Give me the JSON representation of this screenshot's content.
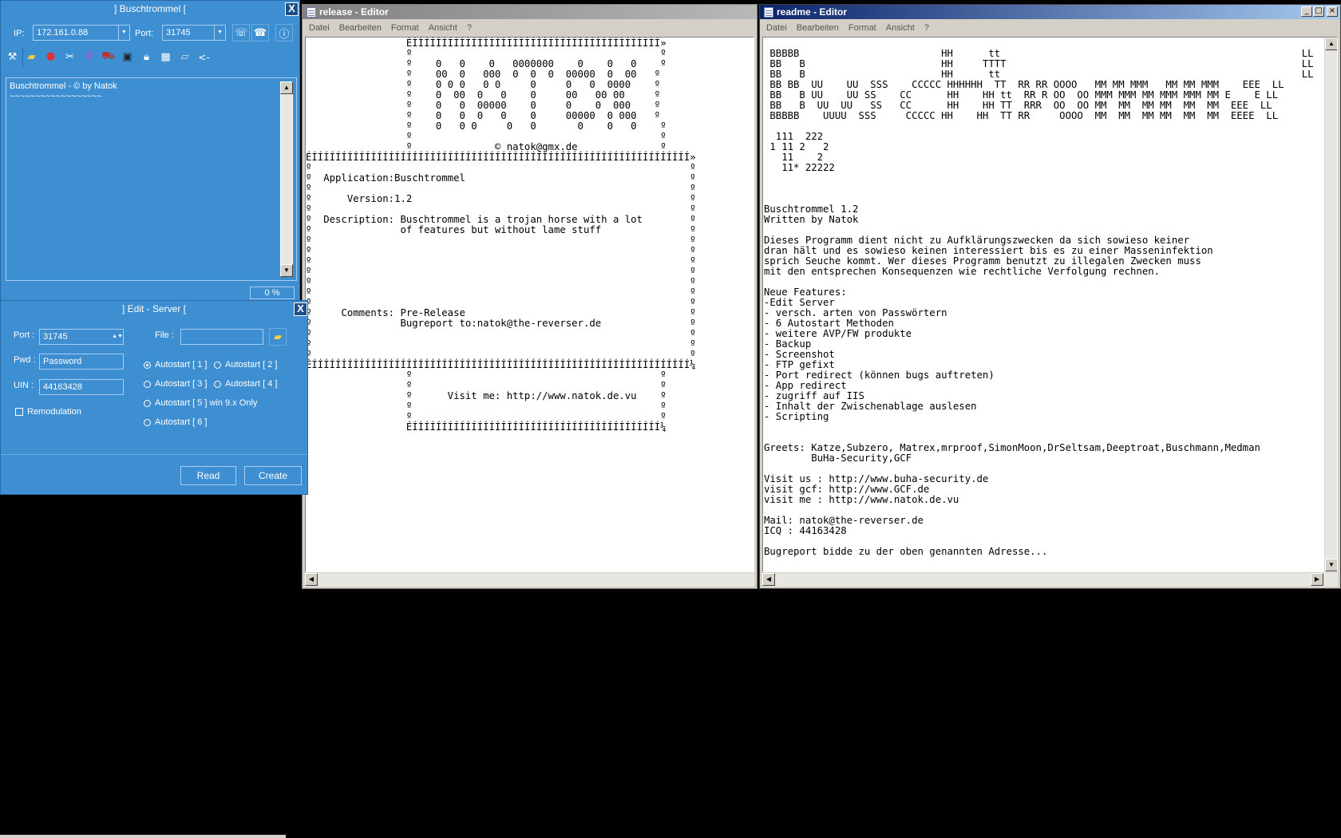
{
  "client": {
    "title": "] Buschtrommel [",
    "close": "X",
    "ip_label": "IP:",
    "ip_value": "172.161.0.88",
    "port_label": "Port:",
    "port_value": "31745",
    "log_lines": [
      "Buschtrommel - © by Natok",
      "~~~~~~~~~~~~~~~~~~"
    ],
    "progress": "0 %",
    "progress_value": 0,
    "toolbar_back": "<-"
  },
  "edit_server": {
    "title": "] Edit - Server [",
    "close": "X",
    "port_label": "Port :",
    "port_value": "31745",
    "pwd_label": "Pwd :",
    "pwd_value": "Password",
    "uin_label": "UIN :",
    "uin_value": "44163428",
    "file_label": "File :",
    "file_value": "",
    "remodulation_label": "Remodulation",
    "autostart": [
      "Autostart  [ 1 ]",
      "Autostart  [ 2 ]",
      "Autostart  [ 3 ]",
      "Autostart  [ 4 ]",
      "Autostart  [ 5 ]  win 9.x Only",
      "Autostart  [ 6 ]"
    ],
    "autostart_selected": "Autostart  [ 1 ]",
    "read_button": "Read",
    "create_button": "Create"
  },
  "release_editor": {
    "title": "release - Editor",
    "menu": [
      "Datei",
      "Bearbeiten",
      "Format",
      "Ansicht",
      "?"
    ],
    "content": "                 ÉÍÍÍÍÍÍÍÍÍÍÍÍÍÍÍÍÍÍÍÍÍÍÍÍÍÍÍÍÍÍÍÍÍÍÍÍÍÍÍÍÍÍ»\n                 º                                          º\n                 º    0   0    0   0000000    0    0   0    º\n                 º    00  0   000  0  0  0  00000  0  00   º\n                 º    0 0 0   0 0     0     0   0  0000    º\n                 º    0  00  0   0    0     00   00 00     º\n                 º    0   0  00000    0     0    0  000    º\n                 º    0   0  0   0    0     00000  0 000   º\n                 º    0   0 0     0   0       0    0   0    º\n                 º                                          º\n                 º              © natok@gmx.de              º\nÉÍÍÍÍÍÍÍÍÍÍÍÍÍÍÍÍÍÍÍÍÍÍÍÍÍÍÍÍÍÍÍÍÍÍÍÍÍÍÍÍÍÍÍÍÍÍÍÍÍÍÍÍÍÍÍÍÍÍÍÍÍÍÍÍ»\nº                                                                º\nº  Application:Buschtrommel                                      º\nº                                                                º\nº      Version:1.2                                               º\nº                                                                º\nº  Description: Buschtrommel is a trojan horse with a lot        º\nº               of features but without lame stuff               º\nº                                                                º\nº                                                                º\nº                                                                º\nº                                                                º\nº                                                                º\nº                                                                º\nº                                                                º\nº     Comments: Pre-Release                                      º\nº               Bugreport to:natok@the-reverser.de               º\nº                                                                º\nº                                                                º\nº                                                                º\nÉÍÍÍÍÍÍÍÍÍÍÍÍÍÍÍÍÍÍÍÍÍÍÍÍÍÍÍÍÍÍÍÍÍÍÍÍÍÍÍÍÍÍÍÍÍÍÍÍÍÍÍÍÍÍÍÍÍÍÍÍÍÍÍÍ¼\n                 º                                          º\n                 º                                          º\n                 º      Visit me: http://www.natok.de.vu    º\n                 º                                          º\n                 º                                          º\n                 ÉÍÍÍÍÍÍÍÍÍÍÍÍÍÍÍÍÍÍÍÍÍÍÍÍÍÍÍÍÍÍÍÍÍÍÍÍÍÍÍÍÍÍ¼"
  },
  "readme_editor": {
    "title": "readme - Editor",
    "menu": [
      "Datei",
      "Bearbeiten",
      "Format",
      "Ansicht",
      "?"
    ],
    "content": "\n BBBBB                        HH      tt                                                   LL\n BB   B                       HH     TTTT                                                  LL\n BB   B                       HH      tt                                                   LL\n BB BB  UU    UU  SSS    CCCCC HHHHHH  TT  RR RR OOOO   MM MM MMM   MM MM MMM    EEE  LL\n BB   B UU    UU SS    CC      HH    HH tt  RR R OO  OO MMM MMM MM MMM MMM MM E    E LL\n BB   B  UU  UU   SS   CC      HH    HH TT  RRR  OO  OO MM  MM  MM MM  MM  MM  EEE  LL\n BBBBB    UUUU  SSS     CCCCC HH    HH  TT RR     OOOO  MM  MM  MM MM  MM  MM  EEEE  LL\n\n  111  222\n 1 11 2   2\n   11    2\n   11* 22222\n\n\n\nBuschtrommel 1.2\nWritten by Natok\n\nDieses Programm dient nicht zu Aufklärungszwecken da sich sowieso keiner\ndran hält und es sowieso keinen interessiert bis es zu einer Masseninfektion\nsprich Seuche kommt. Wer dieses Programm benutzt zu illegalen Zwecken muss\nmit den entsprechen Konsequenzen wie rechtliche Verfolgung rechnen.\n\nNeue Features:\n-Edit Server\n- versch. arten von Passwörtern\n- 6 Autostart Methoden\n- weitere AVP/FW produkte\n- Backup\n- Screenshot\n- FTP gefixt\n- Port redirect (können bugs auftreten)\n- App redirect\n- zugriff auf IIS\n- Inhalt der Zwischenablage auslesen\n- Scripting\n\n\nGreets: Katze,Subzero, Matrex,mrproof,SimonMoon,DrSeltsam,Deeptroat,Buschmann,Medman\n        BuHa-Security,GCF\n\nVisit us : http://www.buha-security.de\nvisit gcf: http://www.GCF.de\nvisit me : http://www.natok.de.vu\n\nMail: natok@the-reverser.de\nICQ : 44163428\n\nBugreport bidde zu der oben genannten Adresse..."
  },
  "colors": {
    "client_blue": "#3d8fd1",
    "titlebar_active": "#0a246a",
    "titlebar_inactive": "#808080"
  }
}
